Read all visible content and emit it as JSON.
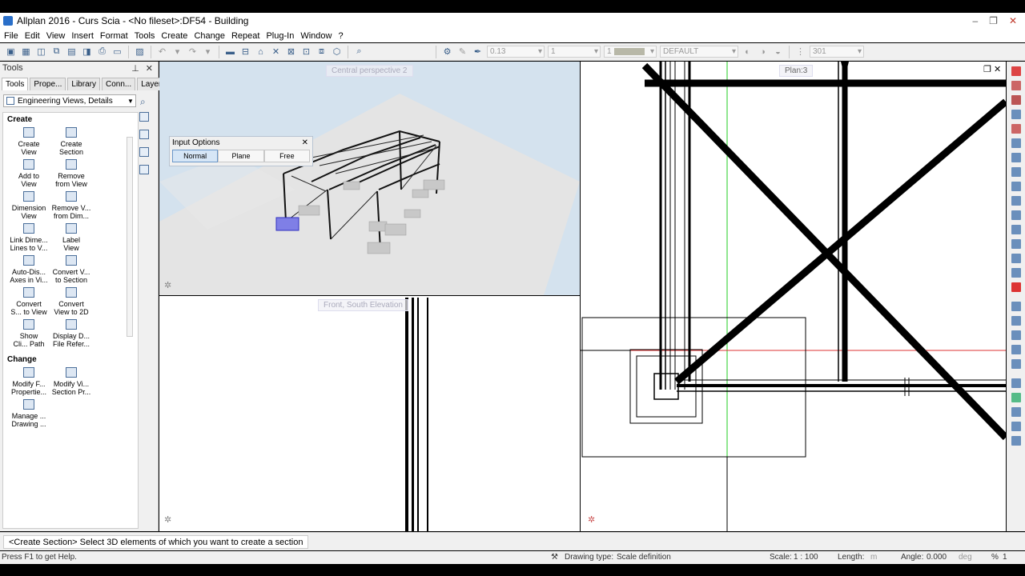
{
  "window": {
    "title": "Allplan 2016 - Curs Scia - <No fileset>:DF54 - Building"
  },
  "menu": [
    "File",
    "Edit",
    "View",
    "Insert",
    "Format",
    "Tools",
    "Create",
    "Change",
    "Repeat",
    "Plug-In",
    "Window",
    "?"
  ],
  "toolbar": {
    "pen_value": "0.13",
    "line_value": "1",
    "color_value": "1",
    "layer_value": "DEFAULT",
    "style_value": "301"
  },
  "panel": {
    "title": "Tools",
    "tabs": [
      "Tools",
      "Prope...",
      "Library",
      "Conn...",
      "Layers"
    ],
    "dropdown": "Engineering Views, Details",
    "create_label": "Create",
    "change_label": "Change",
    "create_tools": [
      [
        "Create",
        "View"
      ],
      [
        "Create",
        "Section"
      ],
      [
        "Add to",
        "View"
      ],
      [
        "Remove",
        "from View"
      ],
      [
        "Dimension",
        "View"
      ],
      [
        "Remove V...",
        "from Dim..."
      ],
      [
        "Link Dime...",
        "Lines to V..."
      ],
      [
        "Label",
        "View"
      ],
      [
        "Auto-Dis...",
        "Axes in Vi..."
      ],
      [
        "Convert V...",
        "to Section"
      ],
      [
        "Convert",
        "S... to View"
      ],
      [
        "Convert",
        "View to 2D"
      ],
      [
        "Show",
        "Cli... Path"
      ],
      [
        "Display D...",
        "File Refer..."
      ]
    ],
    "change_tools": [
      [
        "Modify F...",
        "Propertie..."
      ],
      [
        "Modify Vi...",
        "Section Pr..."
      ],
      [
        "Manage ...",
        "Drawing ..."
      ]
    ]
  },
  "viewports": {
    "perspective": "Central perspective 2",
    "elevation": "Front, South Elevation",
    "plan": "Plan:3"
  },
  "input_options": {
    "title": "Input Options",
    "buttons": [
      "Normal",
      "Plane",
      "Free"
    ],
    "selected": "Normal"
  },
  "command_prompt": "<Create Section> Select 3D elements of which you want to create a section",
  "status": {
    "help": "Press F1 to get Help.",
    "drawing_type_label": "Drawing type:",
    "drawing_type": "Scale definition",
    "scale_label": "Scale:",
    "scale": "1 : 100",
    "length_label": "Length:",
    "length_unit": "m",
    "angle_label": "Angle:",
    "angle": "0.000",
    "angle_unit": "deg",
    "percent": "%",
    "percent_value": "1"
  }
}
